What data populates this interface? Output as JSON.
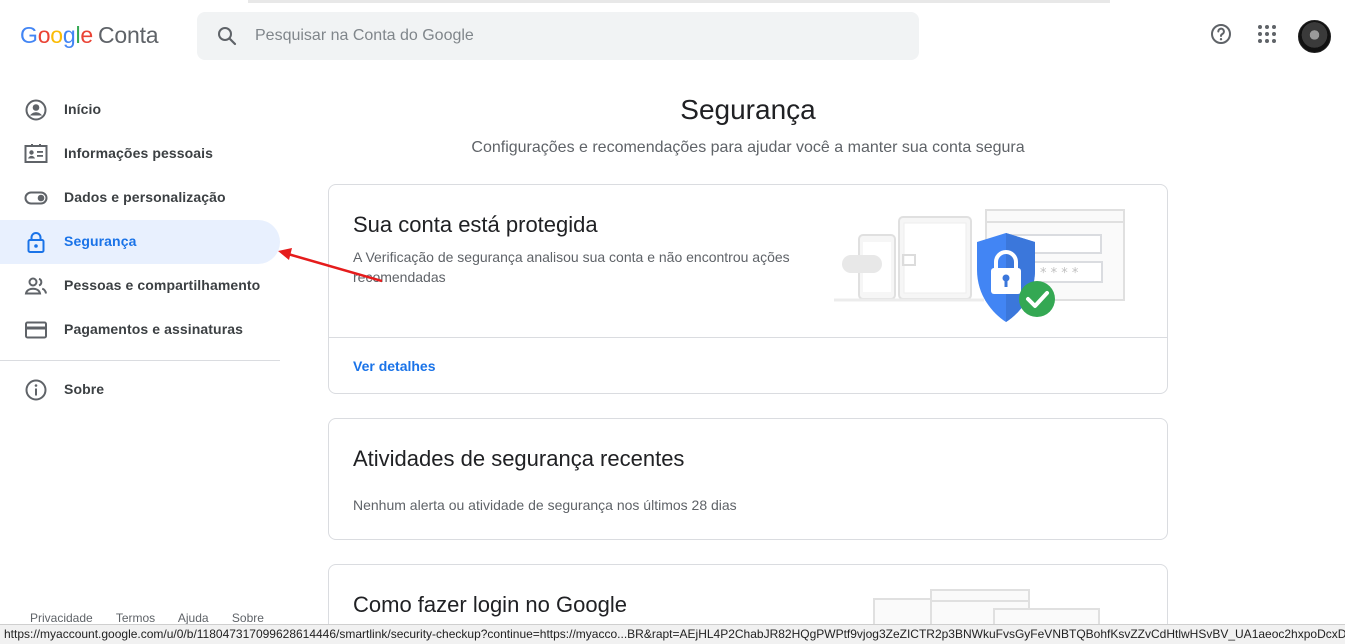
{
  "header": {
    "logo_letters": [
      "G",
      "o",
      "o",
      "g",
      "l",
      "e"
    ],
    "logo_suffix": "Conta",
    "search_placeholder": "Pesquisar na Conta do Google"
  },
  "sidebar": {
    "items": [
      {
        "label": "Início",
        "icon": "account-circle-icon",
        "active": false
      },
      {
        "label": "Informações pessoais",
        "icon": "id-card-icon",
        "active": false
      },
      {
        "label": "Dados e personalização",
        "icon": "toggle-icon",
        "active": false
      },
      {
        "label": "Segurança",
        "icon": "lock-icon",
        "active": true
      },
      {
        "label": "Pessoas e compartilhamento",
        "icon": "people-icon",
        "active": false
      },
      {
        "label": "Pagamentos e assinaturas",
        "icon": "credit-card-icon",
        "active": false
      },
      {
        "label": "Sobre",
        "icon": "info-icon",
        "active": false
      }
    ],
    "footer": [
      "Privacidade",
      "Termos",
      "Ajuda",
      "Sobre"
    ]
  },
  "main": {
    "title": "Segurança",
    "subtitle": "Configurações e recomendações para ajudar você a manter sua conta segura",
    "cards": [
      {
        "title": "Sua conta está protegida",
        "description": "A Verificação de segurança analisou sua conta e não encontrou ações recomendadas",
        "link": "Ver detalhes"
      },
      {
        "title": "Atividades de segurança recentes",
        "description": "Nenhum alerta ou atividade de segurança nos últimos 28 dias"
      },
      {
        "title": "Como fazer login no Google"
      }
    ]
  },
  "colors": {
    "accent": "#1a73e8",
    "active_bg": "#e8f0fe",
    "shield": "#4285f4",
    "check": "#34a853",
    "annotation_arrow": "#e51c1c"
  },
  "statusbar": {
    "url": "https://myaccount.google.com/u/0/b/118047317099628614446/smartlink/security-checkup?continue=https://myacco...BR&rapt=AEjHL4P2ChabJR82HQgPWPtf9vjog3ZeZICTR2p3BNWkuFvsGyFeVNBTQBohfKsvZZvCdHtlwHSvBV_UA1aeoc2hxpoDcxDPaQ"
  }
}
